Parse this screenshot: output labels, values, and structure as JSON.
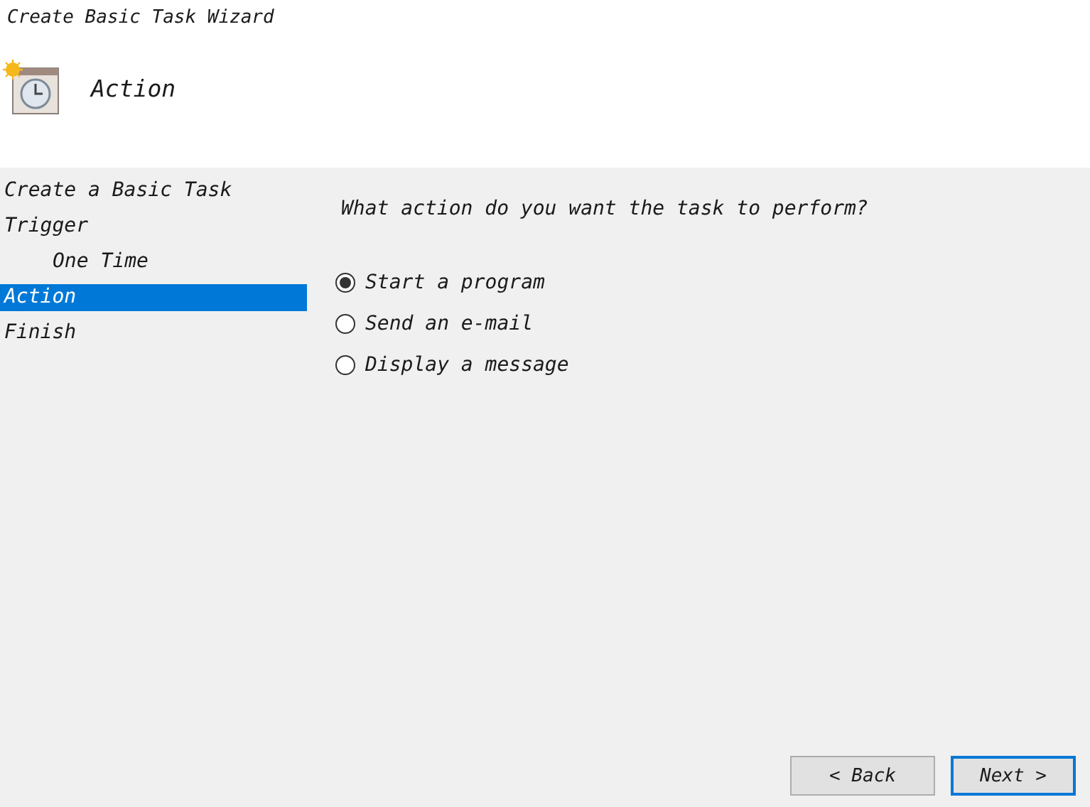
{
  "window": {
    "title": "Create Basic Task Wizard"
  },
  "header": {
    "title": "Action"
  },
  "steps": [
    {
      "label": "Create a Basic Task",
      "selected": false
    },
    {
      "label": "Trigger",
      "selected": false,
      "children": [
        {
          "label": "One Time",
          "selected": false
        }
      ]
    },
    {
      "label": "Action",
      "selected": true
    },
    {
      "label": "Finish",
      "selected": false
    }
  ],
  "question": "What action do you want the task to perform?",
  "options": [
    {
      "label": "Start a program",
      "selected": true
    },
    {
      "label": "Send an e-mail",
      "selected": false
    },
    {
      "label": "Display a message",
      "selected": false
    }
  ],
  "buttons": [
    {
      "label": "< Back",
      "default": false
    },
    {
      "label": "Next >",
      "default": true
    }
  ]
}
